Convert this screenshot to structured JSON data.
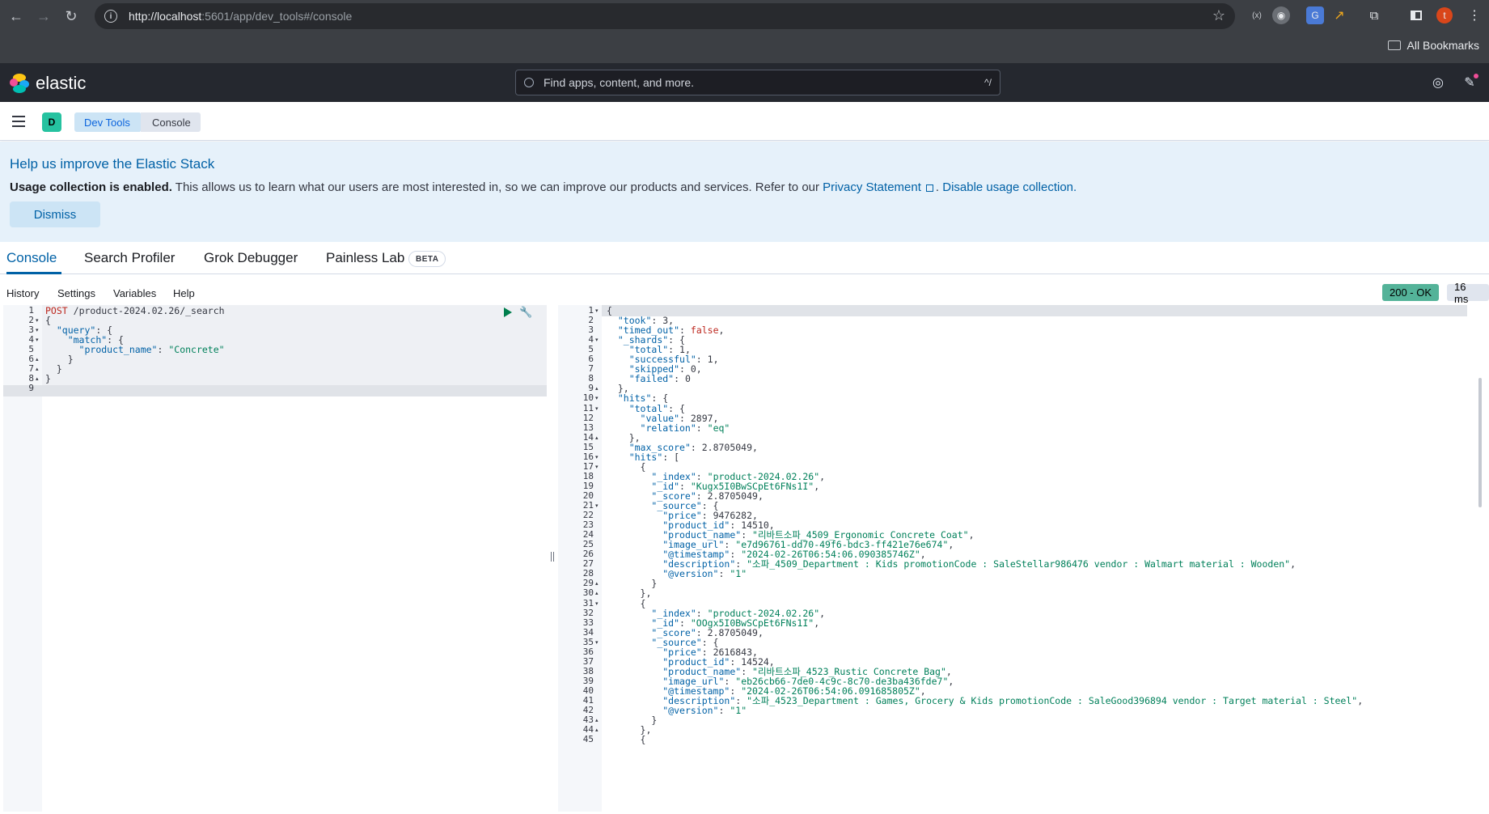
{
  "browser": {
    "url_host": "http://localhost",
    "url_rest": ":5601/app/dev_tools#/console",
    "bookmarks_label": "All Bookmarks",
    "profile_initial": "t"
  },
  "kibana": {
    "logo_text": "elastic",
    "search_placeholder": "Find apps, content, and more.",
    "search_shortcut": "^/",
    "space_initial": "D",
    "breadcrumbs": [
      "Dev Tools",
      "Console"
    ]
  },
  "callout": {
    "title": "Help us improve the Elastic Stack",
    "bold": "Usage collection is enabled.",
    "text": " This allows us to learn what our users are most interested in, so we can improve our products and services. Refer to our ",
    "privacy_link": "Privacy Statement",
    "sep": ". ",
    "disable_link": "Disable usage collection.",
    "dismiss_label": "Dismiss"
  },
  "tabs": [
    {
      "label": "Console",
      "active": true
    },
    {
      "label": "Search Profiler",
      "active": false
    },
    {
      "label": "Grok Debugger",
      "active": false
    },
    {
      "label": "Painless Lab",
      "active": false
    }
  ],
  "beta_badge": "BETA",
  "console_toolbar": [
    "History",
    "Settings",
    "Variables",
    "Help"
  ],
  "response_status": "200 - OK",
  "response_time": "16 ms",
  "request_lines": [
    [
      [
        "mth",
        "POST"
      ],
      [
        "k",
        " "
      ],
      [
        "path",
        "/product-2024.02.26/_search"
      ]
    ],
    [
      [
        "k",
        "{"
      ]
    ],
    [
      [
        "k",
        "  "
      ],
      [
        "key",
        "\"query\""
      ],
      [
        "k",
        ": {"
      ]
    ],
    [
      [
        "k",
        "    "
      ],
      [
        "key",
        "\"match\""
      ],
      [
        "k",
        ": {"
      ]
    ],
    [
      [
        "k",
        "      "
      ],
      [
        "key",
        "\"product_name\""
      ],
      [
        "k",
        ": "
      ],
      [
        "str",
        "\"Concrete\""
      ]
    ],
    [
      [
        "k",
        "    }"
      ]
    ],
    [
      [
        "k",
        "  }"
      ]
    ],
    [
      [
        "k",
        "}"
      ]
    ],
    [
      [
        "k",
        ""
      ]
    ]
  ],
  "response_lines": [
    [
      [
        "k",
        "{"
      ]
    ],
    [
      [
        "k",
        "  "
      ],
      [
        "key",
        "\"took\""
      ],
      [
        "k",
        ": 3,"
      ]
    ],
    [
      [
        "k",
        "  "
      ],
      [
        "key",
        "\"timed_out\""
      ],
      [
        "k",
        ": "
      ],
      [
        "kw",
        "false"
      ],
      [
        "k",
        ","
      ]
    ],
    [
      [
        "k",
        "  "
      ],
      [
        "key",
        "\"_shards\""
      ],
      [
        "k",
        ": {"
      ]
    ],
    [
      [
        "k",
        "    "
      ],
      [
        "key",
        "\"total\""
      ],
      [
        "k",
        ": 1,"
      ]
    ],
    [
      [
        "k",
        "    "
      ],
      [
        "key",
        "\"successful\""
      ],
      [
        "k",
        ": 1,"
      ]
    ],
    [
      [
        "k",
        "    "
      ],
      [
        "key",
        "\"skipped\""
      ],
      [
        "k",
        ": 0,"
      ]
    ],
    [
      [
        "k",
        "    "
      ],
      [
        "key",
        "\"failed\""
      ],
      [
        "k",
        ": 0"
      ]
    ],
    [
      [
        "k",
        "  },"
      ]
    ],
    [
      [
        "k",
        "  "
      ],
      [
        "key",
        "\"hits\""
      ],
      [
        "k",
        ": {"
      ]
    ],
    [
      [
        "k",
        "    "
      ],
      [
        "key",
        "\"total\""
      ],
      [
        "k",
        ": {"
      ]
    ],
    [
      [
        "k",
        "      "
      ],
      [
        "key",
        "\"value\""
      ],
      [
        "k",
        ": 2897,"
      ]
    ],
    [
      [
        "k",
        "      "
      ],
      [
        "key",
        "\"relation\""
      ],
      [
        "k",
        ": "
      ],
      [
        "str",
        "\"eq\""
      ]
    ],
    [
      [
        "k",
        "    },"
      ]
    ],
    [
      [
        "k",
        "    "
      ],
      [
        "key",
        "\"max_score\""
      ],
      [
        "k",
        ": 2.8705049,"
      ]
    ],
    [
      [
        "k",
        "    "
      ],
      [
        "key",
        "\"hits\""
      ],
      [
        "k",
        ": ["
      ]
    ],
    [
      [
        "k",
        "      {"
      ]
    ],
    [
      [
        "k",
        "        "
      ],
      [
        "key",
        "\"_index\""
      ],
      [
        "k",
        ": "
      ],
      [
        "str",
        "\"product-2024.02.26\""
      ],
      [
        "k",
        ","
      ]
    ],
    [
      [
        "k",
        "        "
      ],
      [
        "key",
        "\"_id\""
      ],
      [
        "k",
        ": "
      ],
      [
        "str",
        "\"Kugx5I0BwSCpEt6FNs1I\""
      ],
      [
        "k",
        ","
      ]
    ],
    [
      [
        "k",
        "        "
      ],
      [
        "key",
        "\"_score\""
      ],
      [
        "k",
        ": 2.8705049,"
      ]
    ],
    [
      [
        "k",
        "        "
      ],
      [
        "key",
        "\"_source\""
      ],
      [
        "k",
        ": {"
      ]
    ],
    [
      [
        "k",
        "          "
      ],
      [
        "key",
        "\"price\""
      ],
      [
        "k",
        ": 9476282,"
      ]
    ],
    [
      [
        "k",
        "          "
      ],
      [
        "key",
        "\"product_id\""
      ],
      [
        "k",
        ": 14510,"
      ]
    ],
    [
      [
        "k",
        "          "
      ],
      [
        "key",
        "\"product_name\""
      ],
      [
        "k",
        ": "
      ],
      [
        "str",
        "\"리바트소파_4509_Ergonomic Concrete Coat\""
      ],
      [
        "k",
        ","
      ]
    ],
    [
      [
        "k",
        "          "
      ],
      [
        "key",
        "\"image_url\""
      ],
      [
        "k",
        ": "
      ],
      [
        "str",
        "\"e7d96761-dd70-49f6-bdc3-ff421e76e674\""
      ],
      [
        "k",
        ","
      ]
    ],
    [
      [
        "k",
        "          "
      ],
      [
        "key",
        "\"@timestamp\""
      ],
      [
        "k",
        ": "
      ],
      [
        "str",
        "\"2024-02-26T06:54:06.090385746Z\""
      ],
      [
        "k",
        ","
      ]
    ],
    [
      [
        "k",
        "          "
      ],
      [
        "key",
        "\"description\""
      ],
      [
        "k",
        ": "
      ],
      [
        "str",
        "\"소파_4509_Department : Kids promotionCode : SaleStellar986476 vendor : Walmart material : Wooden\""
      ],
      [
        "k",
        ","
      ]
    ],
    [
      [
        "k",
        "          "
      ],
      [
        "key",
        "\"@version\""
      ],
      [
        "k",
        ": "
      ],
      [
        "str",
        "\"1\""
      ]
    ],
    [
      [
        "k",
        "        }"
      ]
    ],
    [
      [
        "k",
        "      },"
      ]
    ],
    [
      [
        "k",
        "      {"
      ]
    ],
    [
      [
        "k",
        "        "
      ],
      [
        "key",
        "\"_index\""
      ],
      [
        "k",
        ": "
      ],
      [
        "str",
        "\"product-2024.02.26\""
      ],
      [
        "k",
        ","
      ]
    ],
    [
      [
        "k",
        "        "
      ],
      [
        "key",
        "\"_id\""
      ],
      [
        "k",
        ": "
      ],
      [
        "str",
        "\"OOgx5I0BwSCpEt6FNs1I\""
      ],
      [
        "k",
        ","
      ]
    ],
    [
      [
        "k",
        "        "
      ],
      [
        "key",
        "\"_score\""
      ],
      [
        "k",
        ": 2.8705049,"
      ]
    ],
    [
      [
        "k",
        "        "
      ],
      [
        "key",
        "\"_source\""
      ],
      [
        "k",
        ": {"
      ]
    ],
    [
      [
        "k",
        "          "
      ],
      [
        "key",
        "\"price\""
      ],
      [
        "k",
        ": 2616843,"
      ]
    ],
    [
      [
        "k",
        "          "
      ],
      [
        "key",
        "\"product_id\""
      ],
      [
        "k",
        ": 14524,"
      ]
    ],
    [
      [
        "k",
        "          "
      ],
      [
        "key",
        "\"product_name\""
      ],
      [
        "k",
        ": "
      ],
      [
        "str",
        "\"리바트소파_4523_Rustic Concrete Bag\""
      ],
      [
        "k",
        ","
      ]
    ],
    [
      [
        "k",
        "          "
      ],
      [
        "key",
        "\"image_url\""
      ],
      [
        "k",
        ": "
      ],
      [
        "str",
        "\"eb26cb66-7de0-4c9c-8c70-de3ba436fde7\""
      ],
      [
        "k",
        ","
      ]
    ],
    [
      [
        "k",
        "          "
      ],
      [
        "key",
        "\"@timestamp\""
      ],
      [
        "k",
        ": "
      ],
      [
        "str",
        "\"2024-02-26T06:54:06.091685805Z\""
      ],
      [
        "k",
        ","
      ]
    ],
    [
      [
        "k",
        "          "
      ],
      [
        "key",
        "\"description\""
      ],
      [
        "k",
        ": "
      ],
      [
        "str",
        "\"소파_4523_Department : Games, Grocery & Kids promotionCode : SaleGood396894 vendor : Target material : Steel\""
      ],
      [
        "k",
        ","
      ]
    ],
    [
      [
        "k",
        "          "
      ],
      [
        "key",
        "\"@version\""
      ],
      [
        "k",
        ": "
      ],
      [
        "str",
        "\"1\""
      ]
    ],
    [
      [
        "k",
        "        }"
      ]
    ],
    [
      [
        "k",
        "      },"
      ]
    ],
    [
      [
        "k",
        "      {"
      ]
    ]
  ],
  "colors": {
    "primary": "#0061a6",
    "success_badge": "#54b399",
    "header_bg": "#25282f",
    "space_badge": "#25c2a0"
  }
}
